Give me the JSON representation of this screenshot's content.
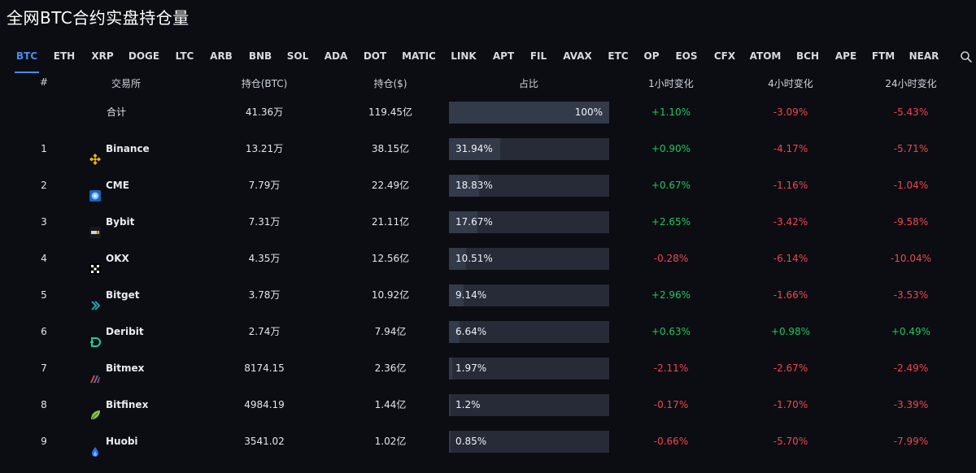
{
  "title": "全网BTC合约实盘持仓量",
  "tabs": [
    "BTC",
    "ETH",
    "XRP",
    "DOGE",
    "LTC",
    "ARB",
    "BNB",
    "SOL",
    "ADA",
    "DOT",
    "MATIC",
    "LINK",
    "APT",
    "FIL",
    "AVAX",
    "ETC",
    "OP",
    "EOS",
    "CFX",
    "ATOM",
    "BCH",
    "APE",
    "FTM",
    "NEAR"
  ],
  "active_tab": "BTC",
  "headers": {
    "num": "#",
    "exchange": "交易所",
    "oi_btc": "持仓(BTC)",
    "oi_usd": "持仓($)",
    "share": "占比",
    "change_1h": "1小时变化",
    "change_4h": "4小时变化",
    "change_24h": "24小时变化"
  },
  "colors": {
    "accent": "#4b8bf0",
    "positive": "#22c55e",
    "negative": "#f0454f"
  },
  "total": {
    "label": "合计",
    "oi_btc": "41.36万",
    "oi_usd": "119.45亿",
    "share": "100%",
    "share_frac": 1.0,
    "change_1h": "+1.10%",
    "change_4h": "-3.09%",
    "change_24h": "-5.43%"
  },
  "rows": [
    {
      "num": "1",
      "exchange": "Binance",
      "icon": "binance-icon",
      "oi_btc": "13.21万",
      "oi_usd": "38.15亿",
      "share": "31.94%",
      "share_frac": 0.3194,
      "change_1h": "+0.90%",
      "change_4h": "-4.17%",
      "change_24h": "-5.71%"
    },
    {
      "num": "2",
      "exchange": "CME",
      "icon": "cme-icon",
      "oi_btc": "7.79万",
      "oi_usd": "22.49亿",
      "share": "18.83%",
      "share_frac": 0.1883,
      "change_1h": "+0.67%",
      "change_4h": "-1.16%",
      "change_24h": "-1.04%"
    },
    {
      "num": "3",
      "exchange": "Bybit",
      "icon": "bybit-icon",
      "oi_btc": "7.31万",
      "oi_usd": "21.11亿",
      "share": "17.67%",
      "share_frac": 0.1767,
      "change_1h": "+2.65%",
      "change_4h": "-3.42%",
      "change_24h": "-9.58%"
    },
    {
      "num": "4",
      "exchange": "OKX",
      "icon": "okx-icon",
      "oi_btc": "4.35万",
      "oi_usd": "12.56亿",
      "share": "10.51%",
      "share_frac": 0.1051,
      "change_1h": "-0.28%",
      "change_4h": "-6.14%",
      "change_24h": "-10.04%"
    },
    {
      "num": "5",
      "exchange": "Bitget",
      "icon": "bitget-icon",
      "oi_btc": "3.78万",
      "oi_usd": "10.92亿",
      "share": "9.14%",
      "share_frac": 0.0914,
      "change_1h": "+2.96%",
      "change_4h": "-1.66%",
      "change_24h": "-3.53%"
    },
    {
      "num": "6",
      "exchange": "Deribit",
      "icon": "deribit-icon",
      "oi_btc": "2.74万",
      "oi_usd": "7.94亿",
      "share": "6.64%",
      "share_frac": 0.0664,
      "change_1h": "+0.63%",
      "change_4h": "+0.98%",
      "change_24h": "+0.49%"
    },
    {
      "num": "7",
      "exchange": "Bitmex",
      "icon": "bitmex-icon",
      "oi_btc": "8174.15",
      "oi_usd": "2.36亿",
      "share": "1.97%",
      "share_frac": 0.0197,
      "change_1h": "-2.11%",
      "change_4h": "-2.67%",
      "change_24h": "-2.49%"
    },
    {
      "num": "8",
      "exchange": "Bitfinex",
      "icon": "bitfinex-icon",
      "oi_btc": "4984.19",
      "oi_usd": "1.44亿",
      "share": "1.2%",
      "share_frac": 0.012,
      "change_1h": "-0.17%",
      "change_4h": "-1.70%",
      "change_24h": "-3.39%"
    },
    {
      "num": "9",
      "exchange": "Huobi",
      "icon": "huobi-icon",
      "oi_btc": "3541.02",
      "oi_usd": "1.02亿",
      "share": "0.85%",
      "share_frac": 0.0085,
      "change_1h": "-0.66%",
      "change_4h": "-5.70%",
      "change_24h": "-7.99%"
    }
  ]
}
